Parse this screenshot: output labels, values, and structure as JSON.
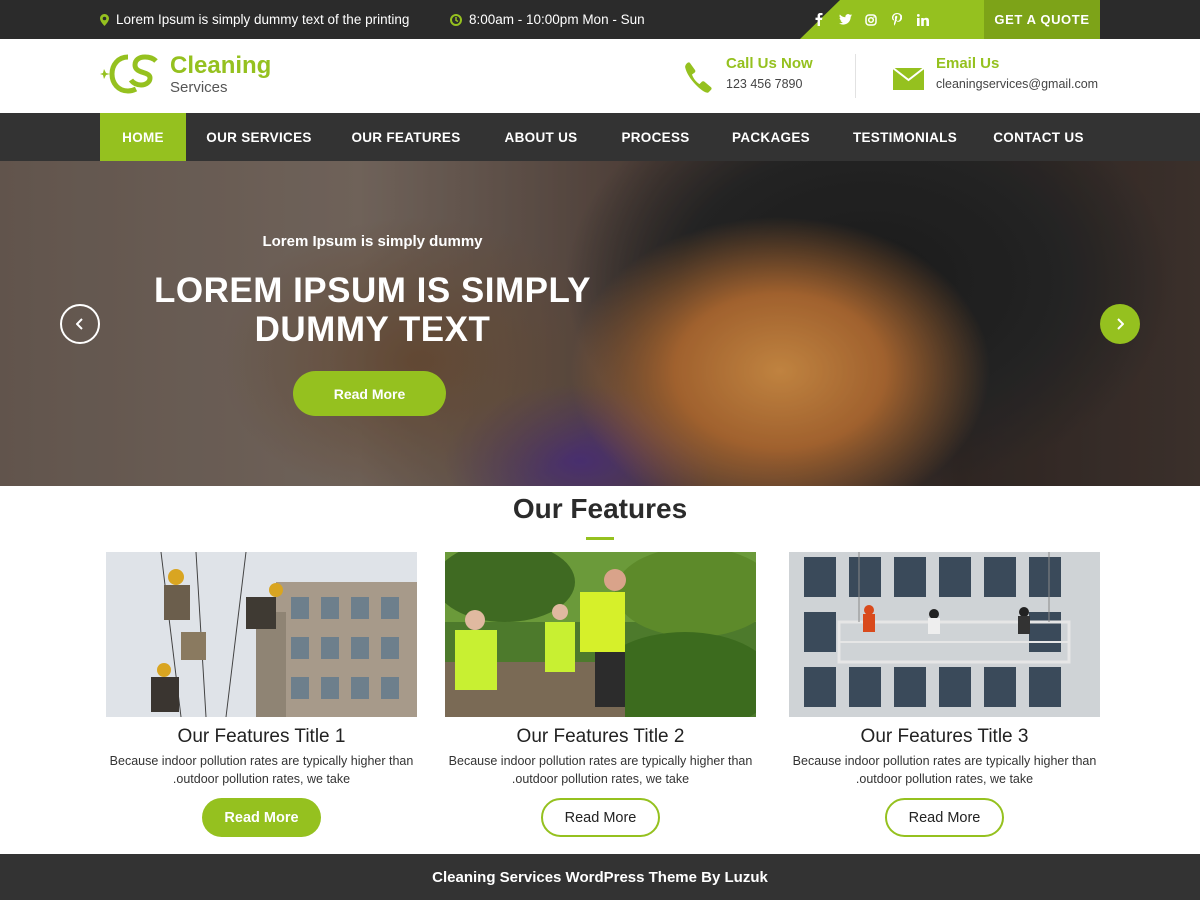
{
  "topbar": {
    "address": "Lorem Ipsum is simply dummy text of the printing",
    "hours": "8:00am - 10:00pm Mon - Sun",
    "socials": [
      "facebook-icon",
      "twitter-icon",
      "instagram-icon",
      "pinterest-icon",
      "linkedin-icon"
    ],
    "quote_label": "GET A QUOTE"
  },
  "header": {
    "logo_line1": "Cleaning",
    "logo_line2": "Services",
    "call_title": "Call Us Now",
    "call_value": "123 456 7890",
    "email_title": "Email Us",
    "email_value": "cleaningservices@gmail.com"
  },
  "nav": {
    "items": [
      "HOME",
      "OUR SERVICES",
      "OUR FEATURES",
      "ABOUT US",
      "PROCESS",
      "PACKAGES",
      "TESTIMONIALS",
      "CONTACT US"
    ],
    "active": "HOME"
  },
  "hero": {
    "subtitle": "Lorem Ipsum is simply dummy",
    "title_line1": "LOREM IPSUM IS SIMPLY",
    "title_line2": "DUMMY TEXT",
    "button": "Read More"
  },
  "features": {
    "heading": "Our Features",
    "cards": [
      {
        "title": "Our Features Title 1",
        "text_line1": "Because indoor pollution rates are typically higher than",
        "text_line2": ".outdoor pollution rates, we take",
        "button": "Read More"
      },
      {
        "title": "Our Features Title 2",
        "text_line1": "Because indoor pollution rates are typically higher than",
        "text_line2": ".outdoor pollution rates, we take",
        "button": "Read More"
      },
      {
        "title": "Our Features Title 3",
        "text_line1": "Because indoor pollution rates are typically higher than",
        "text_line2": ".outdoor pollution rates, we take",
        "button": "Read More"
      }
    ]
  },
  "footer": {
    "text": "Cleaning Services WordPress Theme By Luzuk"
  },
  "colors": {
    "accent": "#95c11f",
    "dark": "#333333",
    "topbar": "#2b2b2b"
  }
}
